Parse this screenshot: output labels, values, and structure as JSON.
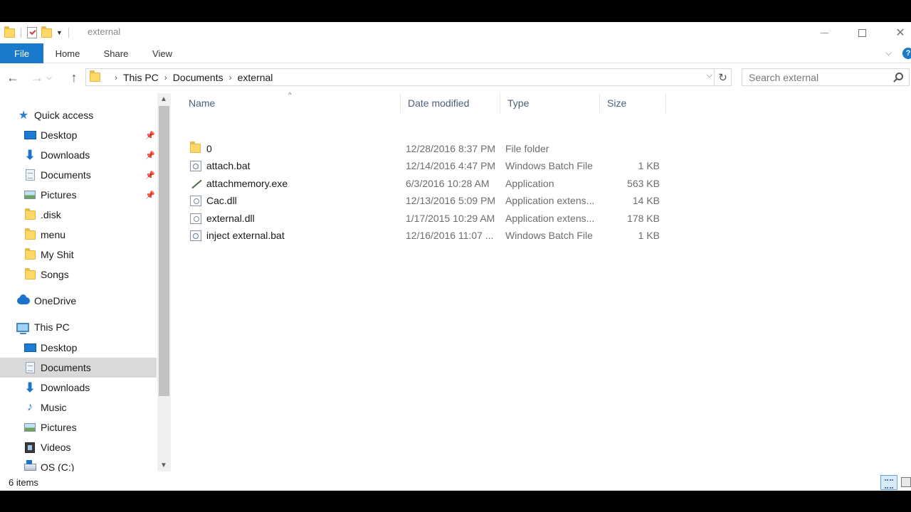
{
  "window": {
    "title": "external",
    "controls": {
      "minimize": "minimize",
      "maximize": "maximize",
      "close": "✕"
    }
  },
  "ribbon": {
    "tabs": [
      "File",
      "Home",
      "Share",
      "View"
    ],
    "help_label": "?"
  },
  "address": {
    "crumbs": [
      "This PC",
      "Documents",
      "external"
    ],
    "search_placeholder": "Search external"
  },
  "nav": {
    "quick_access": "Quick access",
    "quick_items": [
      {
        "label": "Desktop",
        "icon": "desktop-icon",
        "pinned": true
      },
      {
        "label": "Downloads",
        "icon": "downloads-icon",
        "pinned": true
      },
      {
        "label": "Documents",
        "icon": "documents-icon",
        "pinned": true
      },
      {
        "label": "Pictures",
        "icon": "pictures-icon",
        "pinned": true
      },
      {
        "label": ".disk",
        "icon": "folder-icon",
        "pinned": false
      },
      {
        "label": "menu",
        "icon": "folder-icon",
        "pinned": false
      },
      {
        "label": "My Shit",
        "icon": "folder-icon",
        "pinned": false
      },
      {
        "label": "Songs",
        "icon": "folder-icon",
        "pinned": false
      }
    ],
    "onedrive": "OneDrive",
    "this_pc": "This PC",
    "pc_items": [
      {
        "label": "Desktop",
        "icon": "desktop-icon"
      },
      {
        "label": "Documents",
        "icon": "documents-icon",
        "selected": true
      },
      {
        "label": "Downloads",
        "icon": "downloads-icon"
      },
      {
        "label": "Music",
        "icon": "music-icon"
      },
      {
        "label": "Pictures",
        "icon": "pictures-icon"
      },
      {
        "label": "Videos",
        "icon": "videos-icon"
      },
      {
        "label": "OS (C:)",
        "icon": "drive-icon"
      }
    ]
  },
  "files": {
    "columns": {
      "name": "Name",
      "date": "Date modified",
      "type": "Type",
      "size": "Size"
    },
    "rows": [
      {
        "name": "0",
        "date": "12/28/2016 8:37 PM",
        "type": "File folder",
        "size": "",
        "icon": "folder-icon"
      },
      {
        "name": "attach.bat",
        "date": "12/14/2016 4:47 PM",
        "type": "Windows Batch File",
        "size": "1 KB",
        "icon": "batch-file-icon"
      },
      {
        "name": "attachmemory.exe",
        "date": "6/3/2016 10:28 AM",
        "type": "Application",
        "size": "563 KB",
        "icon": "application-icon"
      },
      {
        "name": "Cac.dll",
        "date": "12/13/2016 5:09 PM",
        "type": "Application extens...",
        "size": "14 KB",
        "icon": "dll-icon"
      },
      {
        "name": "external.dll",
        "date": "1/17/2015 10:29 AM",
        "type": "Application extens...",
        "size": "178 KB",
        "icon": "dll-icon"
      },
      {
        "name": "inject external.bat",
        "date": "12/16/2016 11:07 ...",
        "type": "Windows Batch File",
        "size": "1 KB",
        "icon": "batch-file-icon"
      }
    ]
  },
  "status": {
    "item_count": "6 items"
  }
}
